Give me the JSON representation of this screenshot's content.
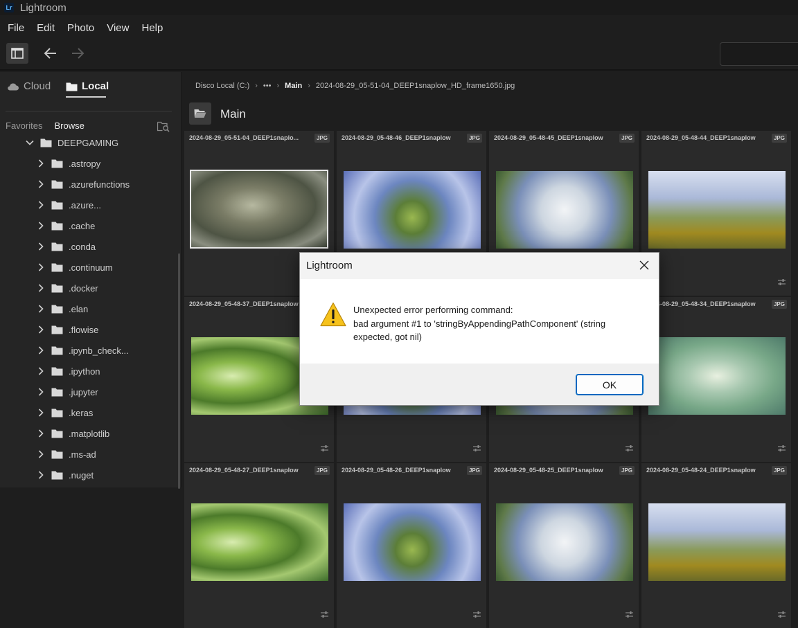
{
  "window": {
    "app_icon_text": "Lr",
    "title": "Lightroom"
  },
  "menubar": [
    "File",
    "Edit",
    "Photo",
    "View",
    "Help"
  ],
  "sidebar": {
    "source_tabs": {
      "cloud": "Cloud",
      "local": "Local"
    },
    "sub_tabs": {
      "favorites": "Favorites",
      "browse": "Browse"
    },
    "root_folder": "DEEPGAMING",
    "folders": [
      ".astropy",
      ".azurefunctions",
      ".azure...",
      ".cache",
      ".conda",
      ".continuum",
      ".docker",
      ".elan",
      ".flowise",
      ".ipynb_check...",
      ".ipython",
      ".jupyter",
      ".keras",
      ".matplotlib",
      ".ms-ad",
      ".nuget"
    ]
  },
  "breadcrumb": {
    "drive": "Disco Local (C:)",
    "ellipsis": "•••",
    "current": "Main",
    "file": "2024-08-29_05-51-04_DEEP1snaplow_HD_frame1650.jpg"
  },
  "folder_title": "Main",
  "grid": {
    "badge": "JPG",
    "items": [
      {
        "name": "2024-08-29_05-51-04_DEEP1snaplo...",
        "tone": "rock",
        "selected": true
      },
      {
        "name": "2024-08-29_05-48-46_DEEP1snaplow",
        "tone": "blue"
      },
      {
        "name": "2024-08-29_05-48-45_DEEP1snaplow",
        "tone": "white"
      },
      {
        "name": "2024-08-29_05-48-44_DEEP1snaplow",
        "tone": "gold"
      },
      {
        "name": "2024-08-29_05-48-37_DEEP1snaplow",
        "tone": "green"
      },
      {
        "name": "",
        "tone": "blue"
      },
      {
        "name": "",
        "tone": "white"
      },
      {
        "name": "2024-08-29_05-48-34_DEEP1snaplow",
        "tone": "aqua"
      },
      {
        "name": "2024-08-29_05-48-27_DEEP1snaplow",
        "tone": "green"
      },
      {
        "name": "2024-08-29_05-48-26_DEEP1snaplow",
        "tone": "blue"
      },
      {
        "name": "2024-08-29_05-48-25_DEEP1snaplow",
        "tone": "white"
      },
      {
        "name": "2024-08-29_05-48-24_DEEP1snaplow",
        "tone": "gold"
      }
    ]
  },
  "dialog": {
    "title": "Lightroom",
    "message_line1": "Unexpected error performing command:",
    "message_line2": "bad argument #1 to 'stringByAppendingPathComponent' (string expected, got nil)",
    "ok": "OK"
  }
}
